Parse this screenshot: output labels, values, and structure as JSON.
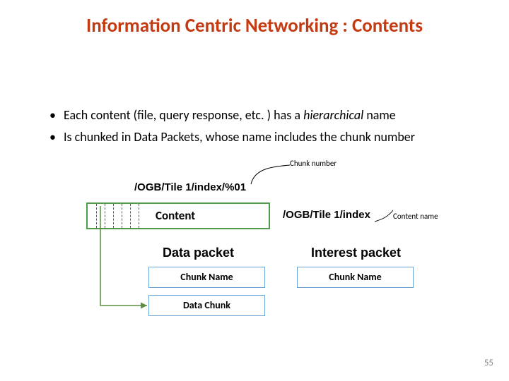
{
  "title": "Information Centric Networking : Contents",
  "bullets": {
    "b1_pre": "Each content (file, query response, etc. ) has a ",
    "b1_em": "hierarchical ",
    "b1_post": "name",
    "b2": "Is chunked in Data Packets, whose name includes the chunk number"
  },
  "diagram": {
    "chunk_number_label": "Chunk number",
    "chunk_name": "/OGB/Tile 1/index/%01",
    "content_box_label": "Content",
    "content_name": "/OGB/Tile 1/index",
    "content_name_label": "Content name",
    "data_packet_label": "Data packet",
    "interest_packet_label": "Interest packet",
    "chunk_name_box": "Chunk Name",
    "data_chunk_box": "Data Chunk"
  },
  "page_number": "55"
}
